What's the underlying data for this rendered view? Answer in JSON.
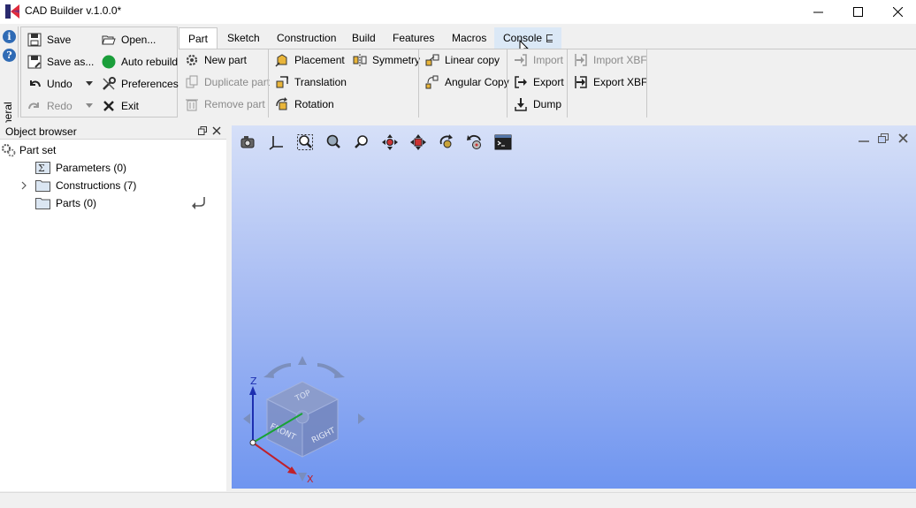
{
  "window": {
    "title": "CAD Builder v.1.0.0*"
  },
  "general_tab": {
    "label": "General"
  },
  "general_panel": {
    "save": "Save",
    "open": "Open...",
    "save_as": "Save as...",
    "auto_rebuild": "Auto rebuild",
    "undo": "Undo",
    "preferences": "Preferences",
    "redo": "Redo",
    "exit": "Exit"
  },
  "ribbon_tabs": [
    "Part",
    "Sketch",
    "Construction",
    "Build",
    "Features",
    "Macros",
    "Console"
  ],
  "ribbon": {
    "new_part": "New part",
    "duplicate_part": "Duplicate part",
    "remove_part": "Remove part",
    "placement": "Placement",
    "translation": "Translation",
    "rotation": "Rotation",
    "symmetry": "Symmetry",
    "linear_copy": "Linear copy",
    "angular_copy": "Angular Copy",
    "import": "Import",
    "export": "Export",
    "dump": "Dump",
    "import_xbf": "Import XBF",
    "export_xbf": "Export XBF"
  },
  "object_browser": {
    "title": "Object browser",
    "root": "Part set",
    "items": [
      {
        "label": "Parameters (0)"
      },
      {
        "label": "Constructions (7)"
      },
      {
        "label": "Parts (0)"
      }
    ]
  },
  "view_cube": {
    "top": "TOP",
    "front": "FRONT",
    "right": "RIGHT",
    "axis_z": "Z",
    "axis_x": "X"
  },
  "colors": {
    "accent": "#2f6bb5",
    "auto_rebuild_on": "#1a9e3a",
    "viewport_top": "#d6e0f8",
    "viewport_bottom": "#6f95f0"
  }
}
